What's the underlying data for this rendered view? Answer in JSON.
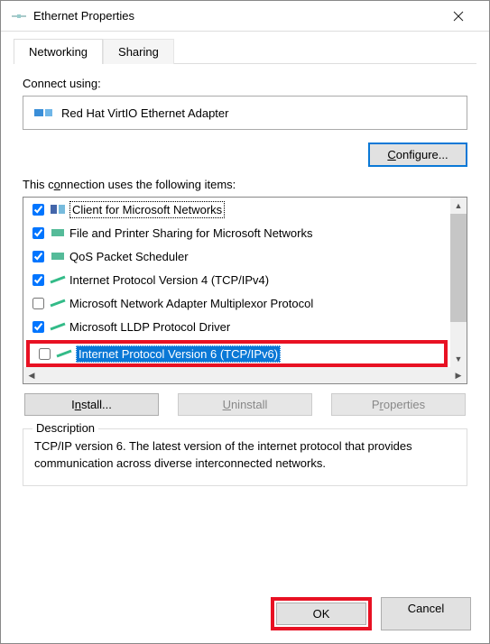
{
  "window": {
    "title": "Ethernet Properties"
  },
  "tabs": {
    "networking": "Networking",
    "sharing": "Sharing"
  },
  "pane": {
    "connect_using": "Connect using:",
    "adapter_name": "Red Hat VirtIO Ethernet Adapter",
    "configure": "Configure...",
    "uses_items": "This connection uses the following items:"
  },
  "items": [
    {
      "label": "Client for Microsoft Networks",
      "checked": true
    },
    {
      "label": "File and Printer Sharing for Microsoft Networks",
      "checked": true
    },
    {
      "label": "QoS Packet Scheduler",
      "checked": true
    },
    {
      "label": "Internet Protocol Version 4 (TCP/IPv4)",
      "checked": true
    },
    {
      "label": "Microsoft Network Adapter Multiplexor Protocol",
      "checked": false
    },
    {
      "label": "Microsoft LLDP Protocol Driver",
      "checked": true
    },
    {
      "label": "Internet Protocol Version 6 (TCP/IPv6)",
      "checked": false
    }
  ],
  "buttons": {
    "install": "Install...",
    "uninstall": "Uninstall",
    "properties": "Properties",
    "ok": "OK",
    "cancel": "Cancel"
  },
  "description": {
    "legend": "Description",
    "text": "TCP/IP version 6. The latest version of the internet protocol that provides communication across diverse interconnected networks."
  }
}
